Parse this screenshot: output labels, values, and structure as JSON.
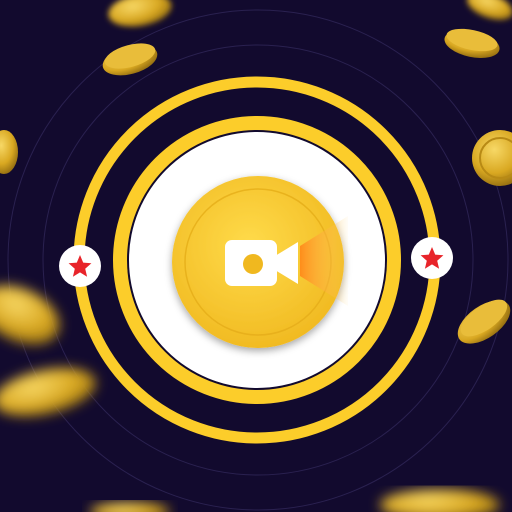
{
  "app_icon": {
    "center_icon": "video-camera-icon",
    "side_markers": [
      "star-icon",
      "star-icon"
    ],
    "decorations": "gold-coins",
    "colors": {
      "background": "#120a2e",
      "ring_yellow": "#fccd2a",
      "disc_white": "#ffffff",
      "button_gold": "#f5c62e",
      "button_gold_light": "#ffdb4a",
      "camera_white": "#ffffff",
      "beam_orange": "#ff9a2a",
      "star_red": "#e8242a",
      "coin_gold": "#d9a821",
      "coin_highlight": "#f7d866"
    }
  }
}
